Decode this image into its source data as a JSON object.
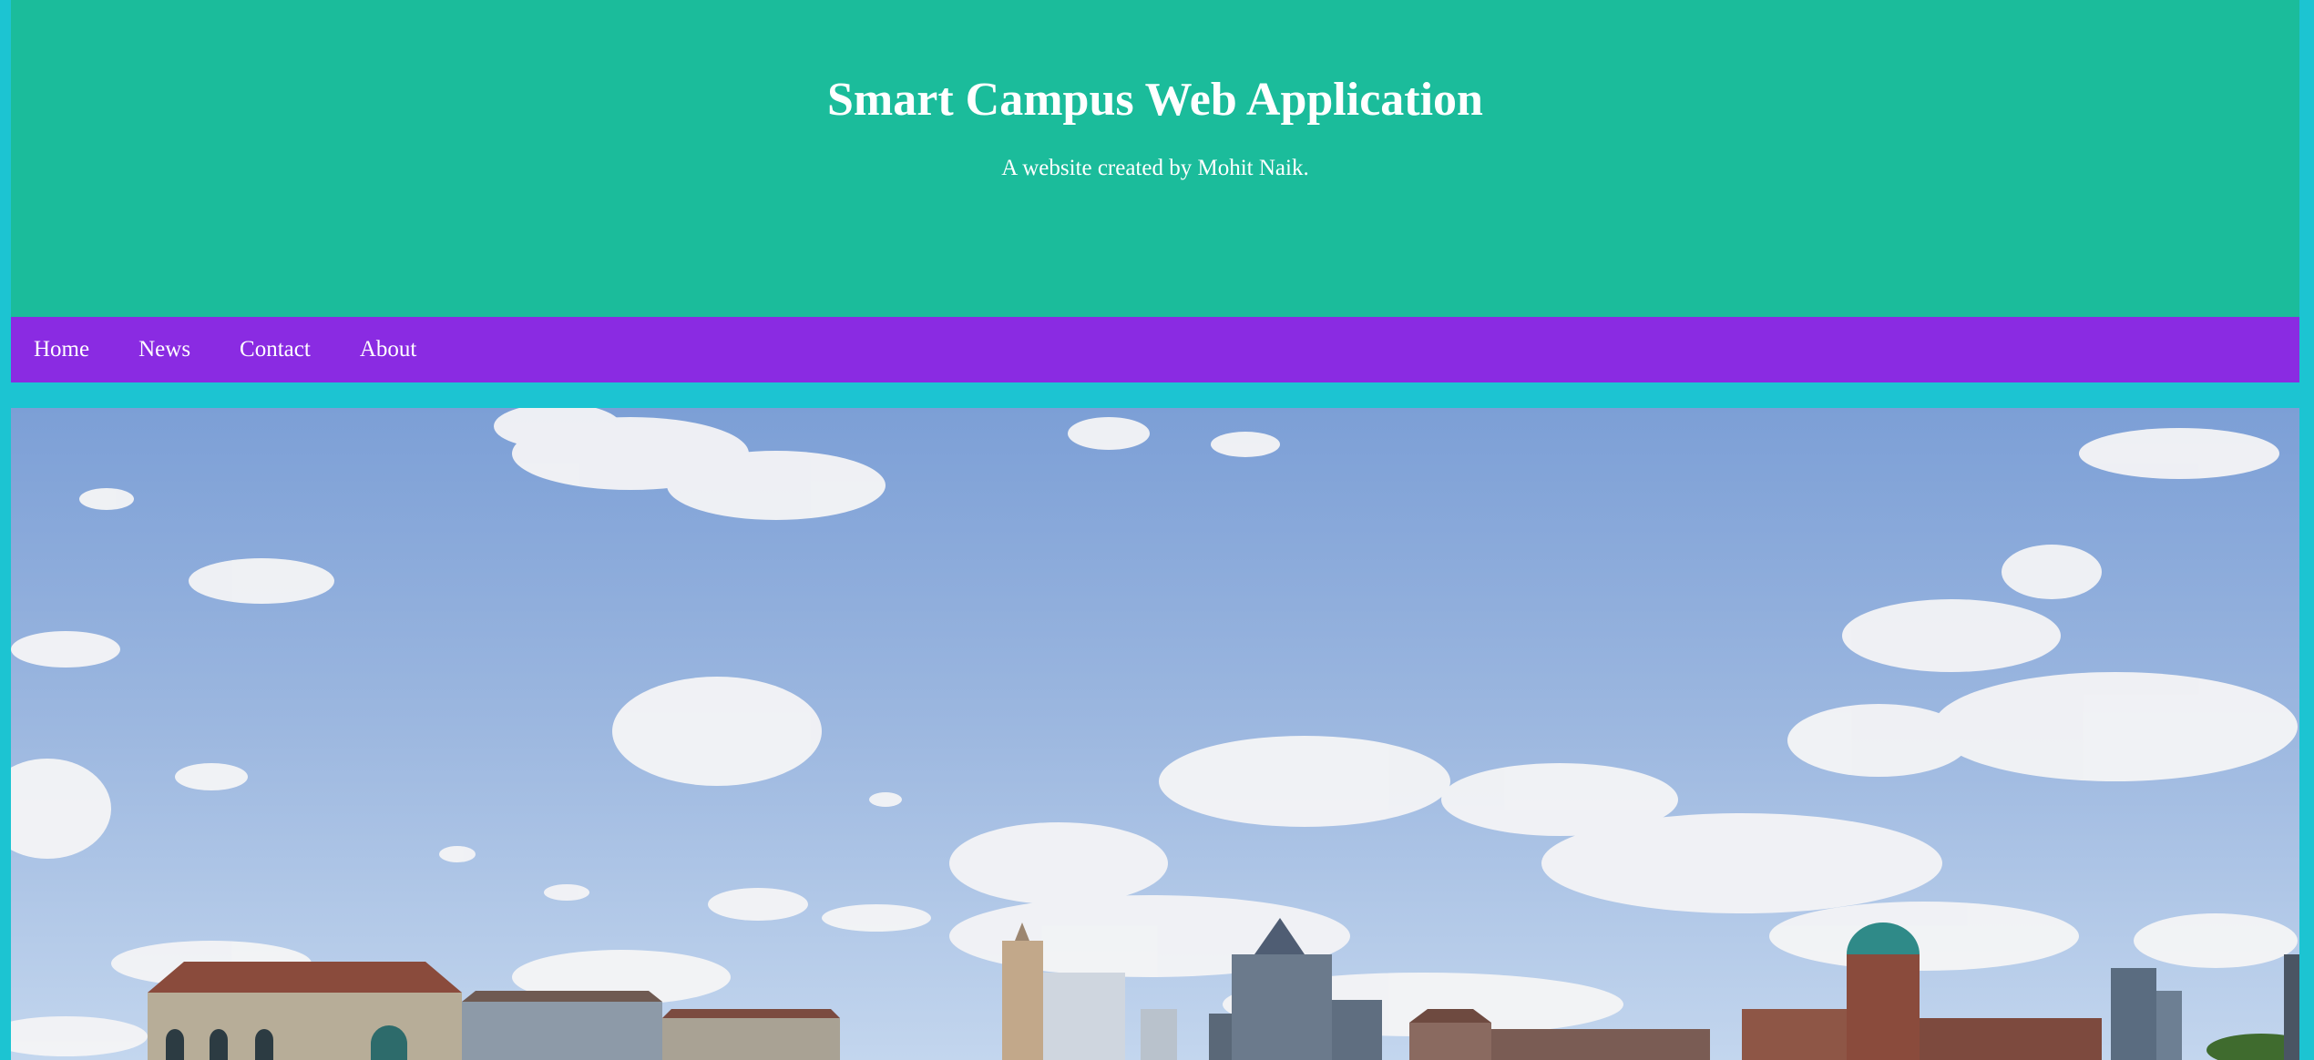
{
  "header": {
    "title": "Smart Campus Web Application",
    "subtitle": "A website created by Mohit Naik."
  },
  "nav": {
    "items": [
      {
        "label": "Home"
      },
      {
        "label": "News"
      },
      {
        "label": "Contact"
      },
      {
        "label": "About"
      }
    ]
  },
  "colors": {
    "page_background": "#1cc4d2",
    "header_background": "#1bbc9b",
    "nav_background": "#8a2be2",
    "text": "#ffffff"
  }
}
